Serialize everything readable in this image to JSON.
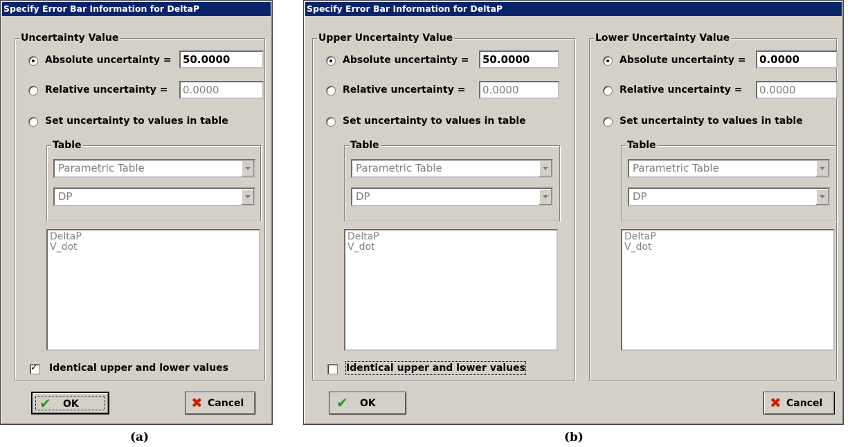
{
  "dialog_a": {
    "title": "Specify Error Bar Information for DeltaP",
    "group_title": "Uncertainty Value",
    "absolute_label": "Absolute uncertainty =",
    "absolute_value": "50.0000",
    "relative_label": "Relative uncertainty =",
    "relative_value": "0.0000",
    "table_option_label": "Set uncertainty to values in table",
    "table_group_title": "Table",
    "table_select": "Parametric Table",
    "column_select": "DP",
    "list_items": [
      "DeltaP",
      "V_dot"
    ],
    "identical_label": "Identical upper and lower values",
    "identical_checked": true,
    "ok_label": "OK",
    "cancel_label": "Cancel",
    "caption": "(a)"
  },
  "dialog_b": {
    "title": "Specify Error Bar Information for DeltaP",
    "upper": {
      "group_title": "Upper Uncertainty Value",
      "absolute_label": "Absolute uncertainty =",
      "absolute_value": "50.0000",
      "relative_label": "Relative uncertainty =",
      "relative_value": "0.0000",
      "table_option_label": "Set uncertainty to values in table",
      "table_group_title": "Table",
      "table_select": "Parametric Table",
      "column_select": "DP",
      "list_items": [
        "DeltaP",
        "V_dot"
      ]
    },
    "lower": {
      "group_title": "Lower Uncertainty Value",
      "absolute_label": "Absolute uncertainty =",
      "absolute_value": "0.0000",
      "relative_label": "Relative uncertainty =",
      "relative_value": "0.0000",
      "table_option_label": "Set uncertainty to values in table",
      "table_group_title": "Table",
      "table_select": "Parametric Table",
      "column_select": "DP",
      "list_items": [
        "DeltaP",
        "V_dot"
      ]
    },
    "identical_label": "Identical upper and lower values",
    "identical_checked": false,
    "ok_label": "OK",
    "cancel_label": "Cancel",
    "caption": "(b)"
  },
  "colors": {
    "title_bar": "#0a246a",
    "dialog_face": "#d4d0c8",
    "ok_check": "#1e9a1e",
    "cancel_x": "#cc2200"
  },
  "icons": {
    "ok": "green-check-icon",
    "cancel": "red-x-icon",
    "dropdown": "chevron-down-icon"
  }
}
